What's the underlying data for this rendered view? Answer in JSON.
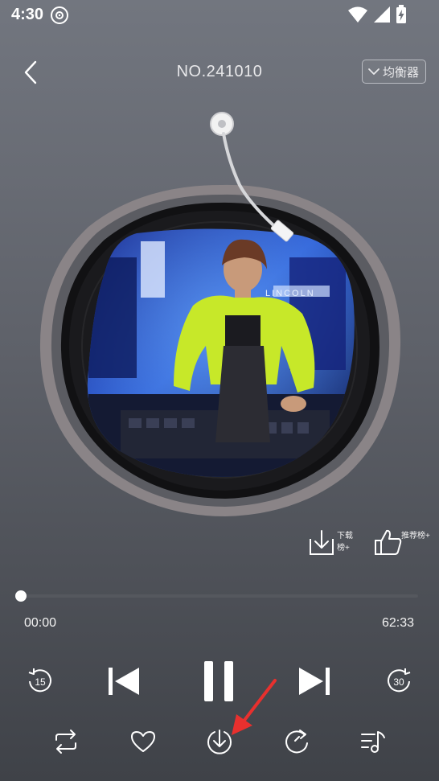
{
  "status_bar": {
    "time": "4:30",
    "icons": [
      "disc-icon",
      "wifi-icon",
      "signal-icon",
      "battery-charging-icon"
    ]
  },
  "header": {
    "back_icon": "chevron-left-icon",
    "title": "NO.241010",
    "equalizer_label": "均衡器",
    "equalizer_icon": "chevron-down-icon"
  },
  "album": {
    "cover_description_icon": "album-cover",
    "record_icon": "vinyl-record",
    "tonearm_icon": "tonearm-icon"
  },
  "side_actions": {
    "download_rank_label": "下载榜+",
    "recommend_rank_label": "推荐榜+"
  },
  "progress": {
    "current_time": "00:00",
    "total_time": "62:33",
    "fraction": 0.0
  },
  "controls": {
    "rewind_seconds": "15",
    "forward_seconds": "30",
    "state": "playing"
  },
  "bottom_bar": {
    "icons": [
      "repeat-icon",
      "heart-icon",
      "download-icon",
      "refresh-icon",
      "playlist-icon"
    ]
  },
  "colors": {
    "arrow_annotation": "#e8302e",
    "icon": "#ffffff",
    "background_top": "#72767f",
    "background_bottom": "#3f4248"
  }
}
